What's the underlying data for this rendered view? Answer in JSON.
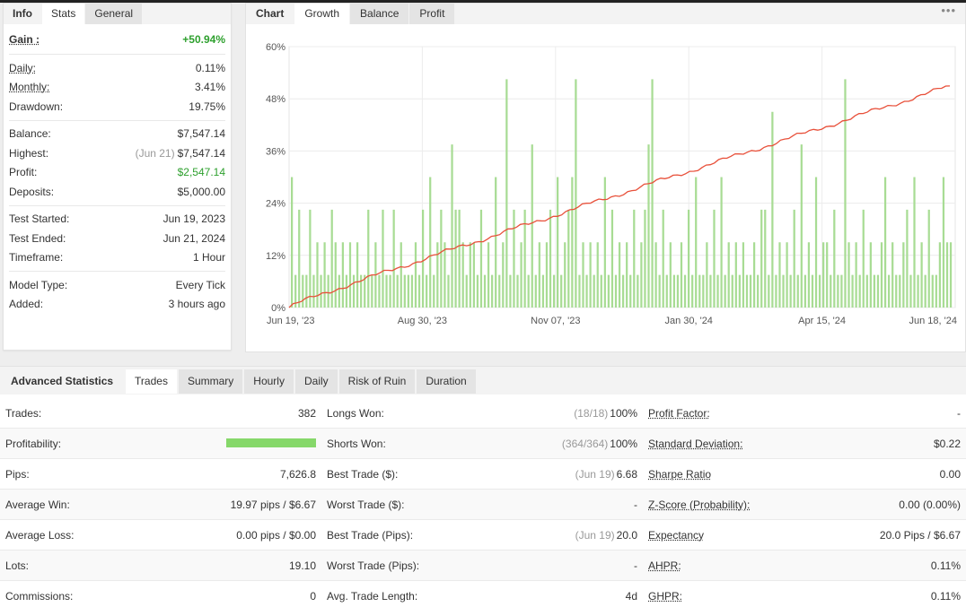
{
  "info_tabs": [
    "Info",
    "Stats",
    "General"
  ],
  "info": {
    "gain": {
      "label": "Gain :",
      "value": "+50.94%"
    },
    "rows1": [
      {
        "label": "Daily:",
        "value": "0.11%"
      },
      {
        "label": "Monthly:",
        "value": "3.41%"
      },
      {
        "label": "Drawdown:",
        "value": "19.75%"
      }
    ],
    "rows2": [
      {
        "label": "Balance:",
        "sub": "",
        "value": "$7,547.14"
      },
      {
        "label": "Highest:",
        "sub": "(Jun 21)",
        "value": "$7,547.14"
      },
      {
        "label": "Profit:",
        "sub": "",
        "value": "$2,547.14"
      },
      {
        "label": "Deposits:",
        "sub": "",
        "value": "$5,000.00"
      }
    ],
    "rows3": [
      {
        "label": "Test Started:",
        "value": "Jun 19, 2023"
      },
      {
        "label": "Test Ended:",
        "value": "Jun 21, 2024"
      },
      {
        "label": "Timeframe:",
        "value": "1 Hour"
      }
    ],
    "rows4": [
      {
        "label": "Model Type:",
        "value": "Every Tick"
      },
      {
        "label": "Added:",
        "value": "3 hours ago"
      }
    ]
  },
  "chart_tabs": [
    "Chart",
    "Growth",
    "Balance",
    "Profit"
  ],
  "chart_menu": "•••",
  "chart_data": {
    "type": "line",
    "title": "",
    "y_ticks": [
      "0%",
      "12%",
      "24%",
      "36%",
      "48%",
      "60%"
    ],
    "ylim": [
      0,
      60
    ],
    "x_ticks": [
      "Jun 19, '23",
      "Aug 30, '23",
      "Nov 07, '23",
      "Jan 30, '24",
      "Apr 15, '24",
      "Jun 18, '24"
    ],
    "growth_start_pct": 0,
    "growth_end_pct": 50.94,
    "bar_heights_pct": [
      30,
      7.5,
      22.5,
      7.5,
      7.5,
      22.5,
      7.5,
      15,
      7.5,
      15,
      7.5,
      22.5,
      15,
      7.5,
      15,
      7.5,
      15,
      7.5,
      15,
      7.5,
      7.5,
      22.5,
      7.5,
      15,
      7.5,
      22.5,
      7.5,
      7.5,
      22.5,
      7.5,
      15,
      7.5,
      7.5,
      7.5,
      15,
      7.5,
      22.5,
      7.5,
      30,
      7.5,
      15,
      22.5,
      15,
      7.5,
      37.5,
      22.5,
      22.5,
      15,
      7.5,
      15,
      15,
      7.5,
      22.5,
      7.5,
      15,
      7.5,
      30,
      7.5,
      15,
      52.5,
      7.5,
      22.5,
      7.5,
      15,
      22.5,
      7.5,
      37.5,
      7.5,
      15,
      7.5,
      15,
      22.5,
      7.5,
      30,
      7.5,
      15,
      22.5,
      30,
      52.5,
      7.5,
      15,
      7.5,
      15,
      7.5,
      15,
      7.5,
      30,
      7.5,
      22.5,
      7.5,
      15,
      7.5,
      15,
      7.5,
      22.5,
      7.5,
      15,
      22.5,
      37.5,
      52.5,
      15,
      7.5,
      22.5,
      7.5,
      15,
      7.5,
      7.5,
      15,
      7.5,
      22.5,
      7.5,
      30,
      7.5,
      7.5,
      15,
      7.5,
      22.5,
      7.5,
      30,
      7.5,
      15,
      7.5,
      15,
      7.5,
      15,
      7.5,
      7.5,
      15,
      7.5,
      22.5,
      22.5,
      7.5,
      45,
      7.5,
      15,
      7.5,
      15,
      7.5,
      22.5,
      7.5,
      37.5,
      7.5,
      15,
      7.5,
      30,
      7.5,
      15,
      15,
      7.5,
      22.5,
      7.5,
      7.5,
      52.5,
      15,
      7.5,
      15,
      7.5,
      22.5,
      7.5,
      15,
      7.5,
      7.5,
      15,
      30,
      7.5,
      15,
      7.5,
      7.5,
      15,
      22.5,
      7.5,
      30,
      7.5,
      15,
      7.5,
      22.5,
      7.5,
      7.5,
      15,
      30,
      15,
      15
    ],
    "gridlines": true
  },
  "adv_tabs": [
    "Advanced Statistics",
    "Trades",
    "Summary",
    "Hourly",
    "Daily",
    "Risk of Ruin",
    "Duration"
  ],
  "stats": [
    [
      {
        "label": "Trades:",
        "sub": "",
        "value": "382",
        "ul": false
      },
      {
        "label": "Longs Won:",
        "sub": "(18/18)",
        "value": "100%",
        "ul": false
      },
      {
        "label": "Profit Factor:",
        "sub": "",
        "value": "-",
        "ul": true
      }
    ],
    [
      {
        "label": "Profitability:",
        "sub": "",
        "value": "",
        "ul": false,
        "bar": true,
        "bar_fraction": 1.0
      },
      {
        "label": "Shorts Won:",
        "sub": "(364/364)",
        "value": "100%",
        "ul": false
      },
      {
        "label": "Standard Deviation:",
        "sub": "",
        "value": "$0.22",
        "ul": true
      }
    ],
    [
      {
        "label": "Pips:",
        "sub": "",
        "value": "7,626.8",
        "ul": false
      },
      {
        "label": "Best Trade ($):",
        "sub": "(Jun 19)",
        "value": "6.68",
        "ul": false
      },
      {
        "label": "Sharpe Ratio",
        "sub": "",
        "value": "0.00",
        "ul": true
      }
    ],
    [
      {
        "label": "Average Win:",
        "sub": "",
        "value": "19.97 pips / $6.67",
        "ul": false
      },
      {
        "label": "Worst Trade ($):",
        "sub": "",
        "value": "-",
        "ul": false
      },
      {
        "label": "Z-Score (Probability):",
        "sub": "",
        "value": "0.00 (0.00%)",
        "ul": true
      }
    ],
    [
      {
        "label": "Average Loss:",
        "sub": "",
        "value": "0.00 pips / $0.00",
        "ul": false
      },
      {
        "label": "Best Trade (Pips):",
        "sub": "(Jun 19)",
        "value": "20.0",
        "ul": false
      },
      {
        "label": "Expectancy",
        "sub": "",
        "value": "20.0 Pips / $6.67",
        "ul": true
      }
    ],
    [
      {
        "label": "Lots:",
        "sub": "",
        "value": "19.10",
        "ul": false
      },
      {
        "label": "Worst Trade (Pips):",
        "sub": "",
        "value": "-",
        "ul": false
      },
      {
        "label": "AHPR:",
        "sub": "",
        "value": "0.11%",
        "ul": true
      }
    ],
    [
      {
        "label": "Commissions:",
        "sub": "",
        "value": "0",
        "ul": false
      },
      {
        "label": "Avg. Trade Length:",
        "sub": "",
        "value": "4d",
        "ul": false
      },
      {
        "label": "GHPR:",
        "sub": "",
        "value": "0.11%",
        "ul": true
      }
    ]
  ],
  "colors": {
    "growth_line": "#e8503a",
    "bars": "#a8dc94",
    "gain_green": "#2ea02e"
  }
}
